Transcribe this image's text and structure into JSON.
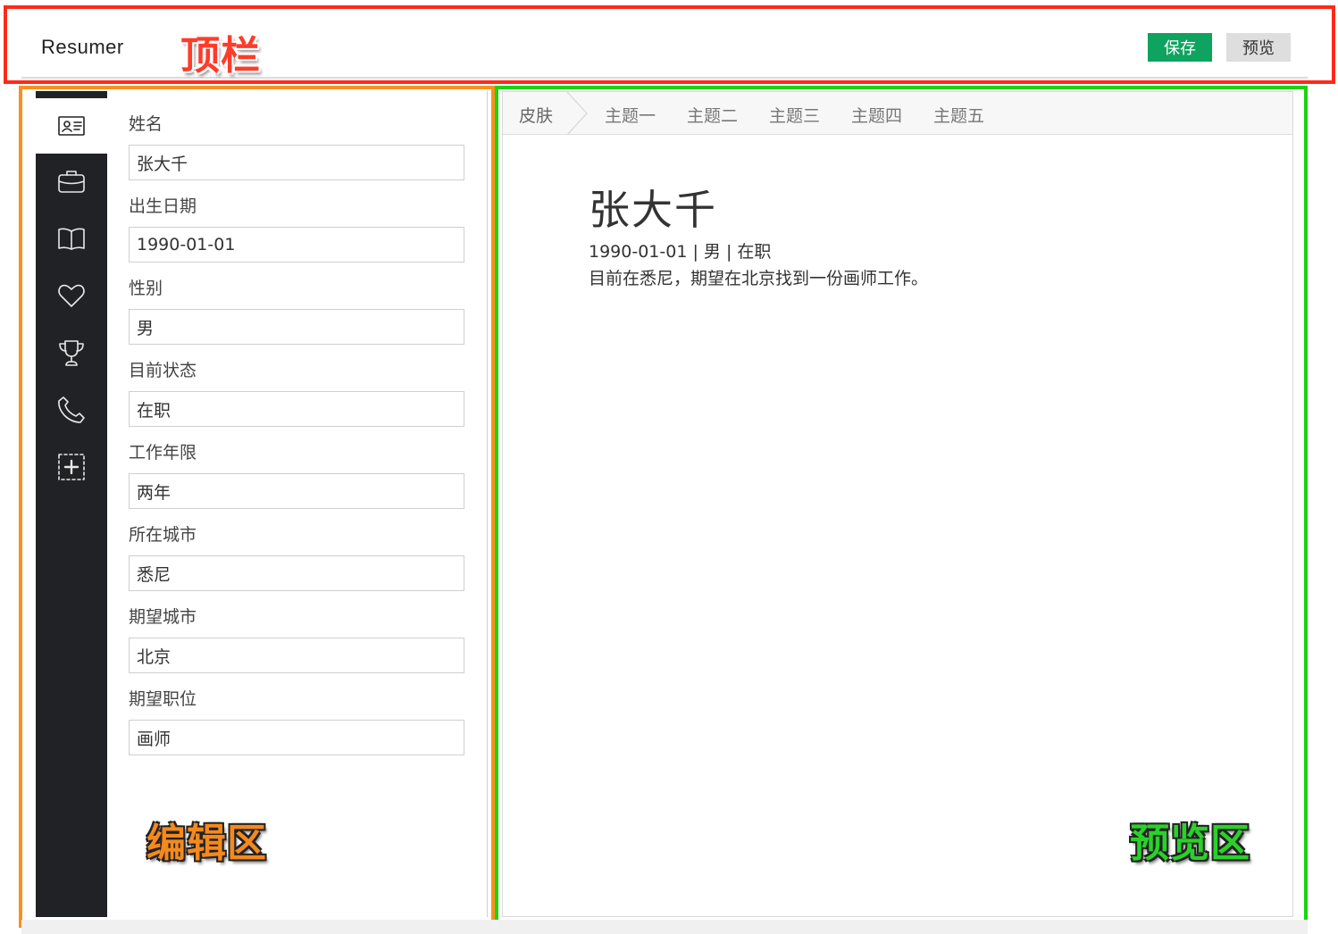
{
  "annotation_tags": {
    "topbar": "顶栏",
    "editor": "编辑区",
    "preview": "预览区"
  },
  "colors": {
    "topbar_frame": "#ff2a1a",
    "editor_frame": "#f7901e",
    "preview_frame": "#1bd40f",
    "save_button": "#0ea35e",
    "sidebar_bg": "#212226"
  },
  "topbar": {
    "logo": "Resumer",
    "save_label": "保存",
    "preview_label": "预览"
  },
  "sidebar": {
    "items": [
      {
        "icon": "id-card-icon",
        "active": true
      },
      {
        "icon": "briefcase-icon",
        "active": false
      },
      {
        "icon": "book-icon",
        "active": false
      },
      {
        "icon": "heart-icon",
        "active": false
      },
      {
        "icon": "trophy-icon",
        "active": false
      },
      {
        "icon": "phone-icon",
        "active": false
      },
      {
        "icon": "add-section-icon",
        "active": false
      }
    ]
  },
  "form": {
    "fields": [
      {
        "label": "姓名",
        "value": "张大千"
      },
      {
        "label": "出生日期",
        "value": "1990-01-01"
      },
      {
        "label": "性别",
        "value": "男"
      },
      {
        "label": "目前状态",
        "value": "在职"
      },
      {
        "label": "工作年限",
        "value": "两年"
      },
      {
        "label": "所在城市",
        "value": "悉尼"
      },
      {
        "label": "期望城市",
        "value": "北京"
      },
      {
        "label": "期望职位",
        "value": "画师"
      }
    ]
  },
  "preview": {
    "skin_label": "皮肤",
    "themes": [
      "主题一",
      "主题二",
      "主题三",
      "主题四",
      "主题五"
    ],
    "resume": {
      "name": "张大千",
      "meta": "1990-01-01 | 男 | 在职",
      "intro": "目前在悉尼，期望在北京找到一份画师工作。"
    }
  }
}
